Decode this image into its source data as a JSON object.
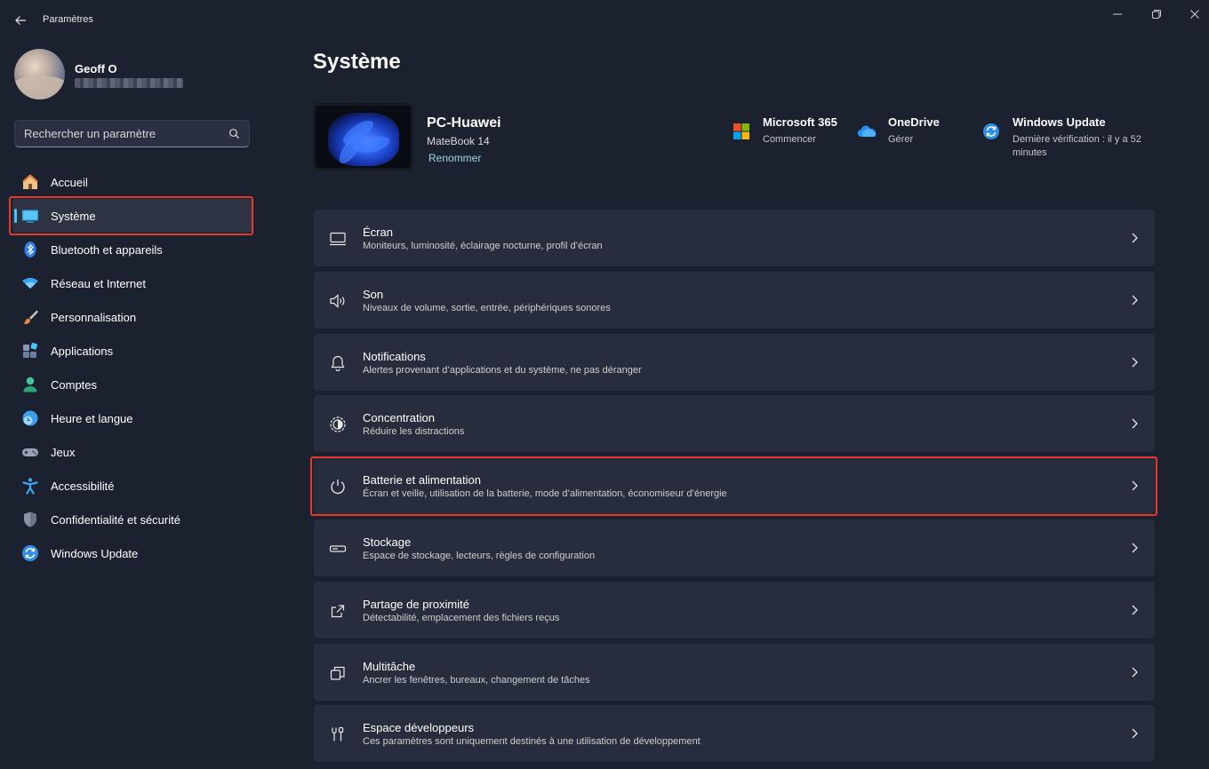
{
  "window": {
    "title": "Paramètres",
    "accent": "#4cc2ff",
    "highlight_color": "#e53a2a"
  },
  "profile": {
    "name": "Geoff O"
  },
  "search": {
    "placeholder": "Rechercher un paramètre"
  },
  "sidebar": {
    "items": [
      {
        "label": "Accueil",
        "icon": "home-icon"
      },
      {
        "label": "Système",
        "icon": "monitor-icon",
        "active": true
      },
      {
        "label": "Bluetooth et appareils",
        "icon": "bluetooth-icon"
      },
      {
        "label": "Réseau et Internet",
        "icon": "wifi-icon"
      },
      {
        "label": "Personnalisation",
        "icon": "brush-icon"
      },
      {
        "label": "Applications",
        "icon": "apps-icon"
      },
      {
        "label": "Comptes",
        "icon": "person-icon"
      },
      {
        "label": "Heure et langue",
        "icon": "clock-globe-icon"
      },
      {
        "label": "Jeux",
        "icon": "gamepad-icon"
      },
      {
        "label": "Accessibilité",
        "icon": "accessibility-icon"
      },
      {
        "label": "Confidentialité et sécurité",
        "icon": "shield-icon"
      },
      {
        "label": "Windows Update",
        "icon": "sync-icon"
      }
    ]
  },
  "main": {
    "title": "Système",
    "device": {
      "name": "PC-Huawei",
      "model": "MateBook 14",
      "rename": "Renommer"
    },
    "quick": [
      {
        "title": "Microsoft 365",
        "sub": "Commencer",
        "icon": "microsoft-logo-icon"
      },
      {
        "title": "OneDrive",
        "sub": "Gérer",
        "icon": "cloud-icon"
      },
      {
        "title": "Windows Update",
        "sub": "Dernière vérification : il y a 52 minutes",
        "icon": "sync-icon"
      }
    ],
    "rows": [
      {
        "title": "Écran",
        "sub": "Moniteurs, luminosité, éclairage nocturne, profil d’écran",
        "icon": "display-icon"
      },
      {
        "title": "Son",
        "sub": "Niveaux de volume, sortie, entrée, périphériques sonores",
        "icon": "speaker-icon"
      },
      {
        "title": "Notifications",
        "sub": "Alertes provenant d’applications et du système, ne pas déranger",
        "icon": "bell-icon"
      },
      {
        "title": "Concentration",
        "sub": "Réduire les distractions",
        "icon": "focus-icon"
      },
      {
        "title": "Batterie et alimentation",
        "sub": "Écran et veille, utilisation de la batterie, mode d’alimentation, économiseur d’énergie",
        "icon": "power-icon"
      },
      {
        "title": "Stockage",
        "sub": "Espace de stockage, lecteurs, règles de configuration",
        "icon": "storage-icon"
      },
      {
        "title": "Partage de proximité",
        "sub": "Détectabilité, emplacement des fichiers reçus",
        "icon": "share-icon"
      },
      {
        "title": "Multitâche",
        "sub": "Ancrer les fenêtres, bureaux, changement de tâches",
        "icon": "multitask-icon"
      },
      {
        "title": "Espace développeurs",
        "sub": "Ces paramètres sont uniquement destinés à une utilisation de développement",
        "icon": "tools-icon"
      }
    ]
  }
}
